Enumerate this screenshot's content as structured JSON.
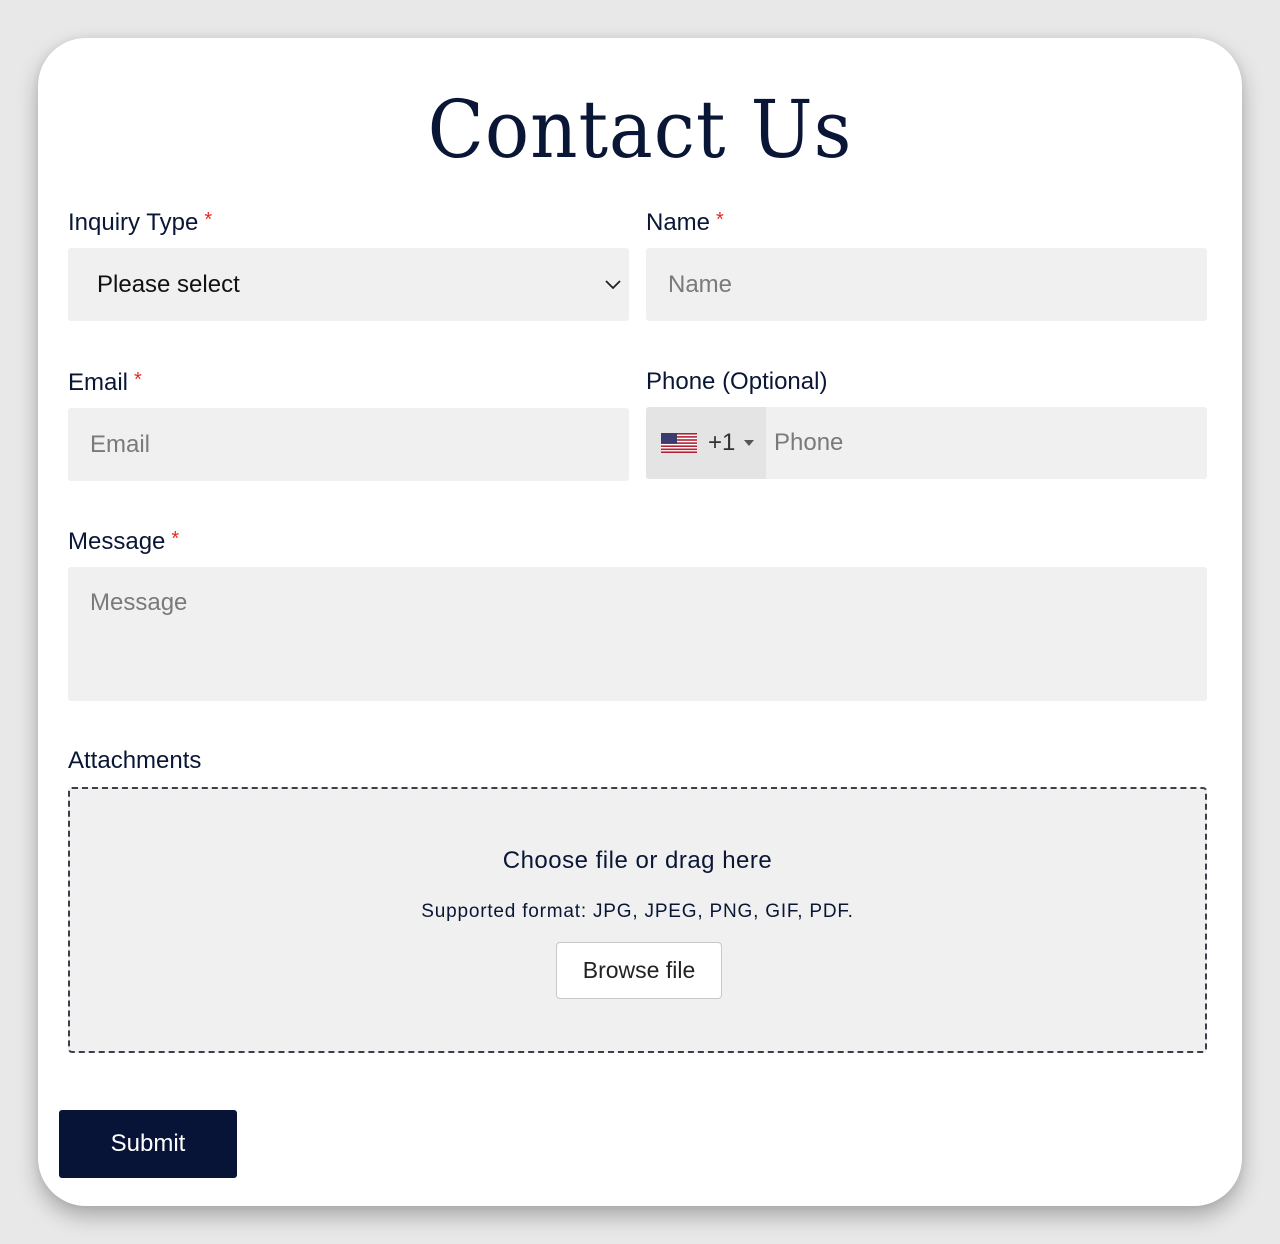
{
  "title": "Contact Us",
  "form": {
    "inquiry_type": {
      "label": "Inquiry Type",
      "required_mark": "*",
      "selected": "Please select"
    },
    "name": {
      "label": "Name",
      "required_mark": "*",
      "placeholder": "Name"
    },
    "email": {
      "label": "Email",
      "required_mark": "*",
      "placeholder": "Email"
    },
    "phone": {
      "label": "Phone (Optional)",
      "country_icon": "us-flag-icon",
      "dial_code": "+1",
      "placeholder": "Phone"
    },
    "message": {
      "label": "Message",
      "required_mark": "*",
      "placeholder": "Message"
    },
    "attachments": {
      "label": "Attachments",
      "prompt": "Choose file or drag here",
      "formats": "Supported format: JPG, JPEG, PNG, GIF, PDF.",
      "browse_label": "Browse file"
    },
    "submit_label": "Submit"
  },
  "colors": {
    "brand": "#071438",
    "required": "#e02b20",
    "field_bg": "#f0f0f0"
  }
}
